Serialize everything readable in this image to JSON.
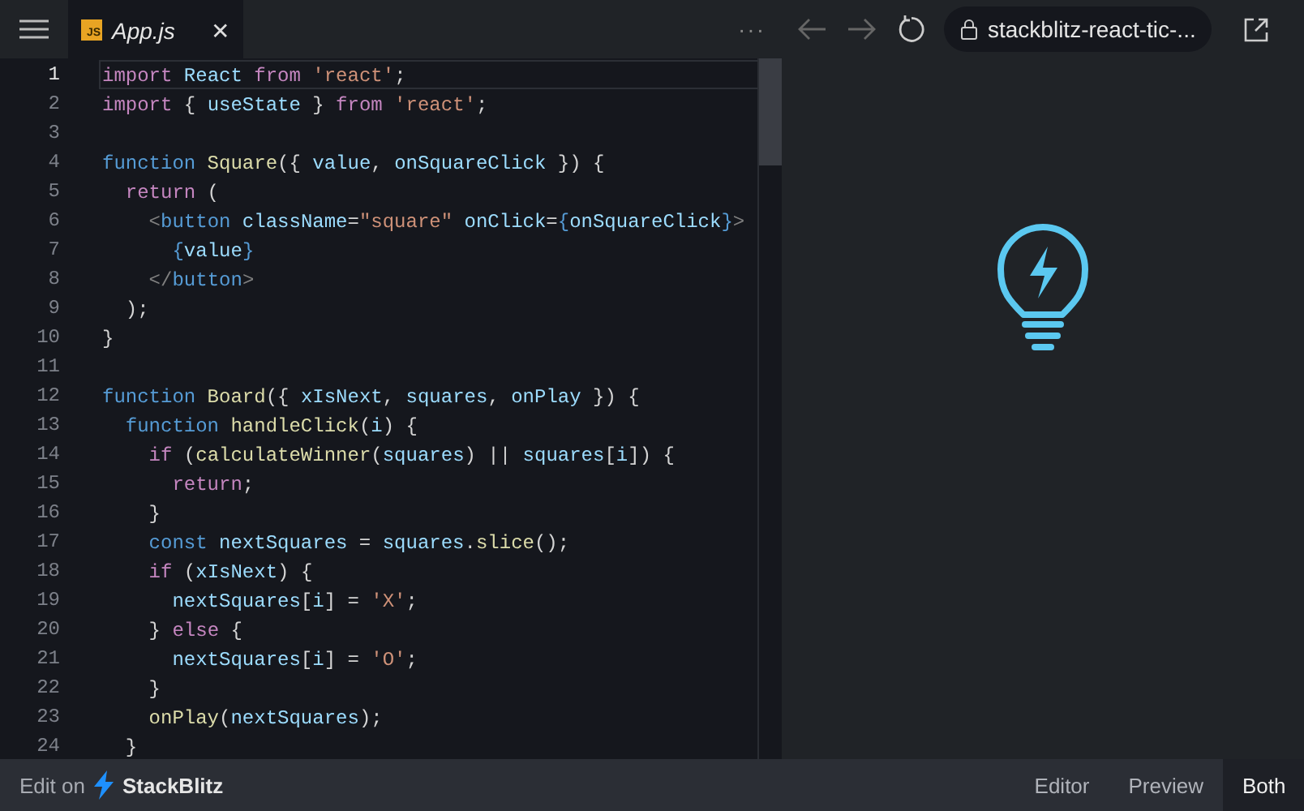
{
  "tab": {
    "icon": "JS",
    "label": "App.js",
    "close": "✕"
  },
  "more": "···",
  "url": "stackblitz-react-tic-...",
  "code": [
    {
      "number": "1",
      "active": true,
      "tokens": [
        {
          "text": "import",
          "kind": "kw"
        },
        {
          "text": " React ",
          "kind": "var"
        },
        {
          "text": "from",
          "kind": "kw"
        },
        {
          "text": " 'react'",
          "kind": "str"
        },
        {
          "text": ";",
          "kind": "p"
        }
      ]
    },
    {
      "number": "2",
      "active": false,
      "tokens": [
        {
          "text": "import",
          "kind": "kw"
        },
        {
          "text": " { ",
          "kind": "p"
        },
        {
          "text": "useState",
          "kind": "var"
        },
        {
          "text": " } ",
          "kind": "p"
        },
        {
          "text": "from",
          "kind": "kw"
        },
        {
          "text": " 'react'",
          "kind": "str"
        },
        {
          "text": ";",
          "kind": "p"
        }
      ]
    },
    {
      "number": "3",
      "active": false
    },
    {
      "number": "4",
      "active": false,
      "tokens": [
        {
          "text": "function",
          "kind": "st"
        },
        {
          "text": " Square",
          "kind": "fn"
        },
        {
          "text": "({ ",
          "kind": "p"
        },
        {
          "text": "value",
          "kind": "var"
        },
        {
          "text": ", ",
          "kind": "p"
        },
        {
          "text": "onSquareClick",
          "kind": "var"
        },
        {
          "text": " }) {",
          "kind": "p"
        }
      ]
    },
    {
      "number": "5",
      "active": false,
      "tokens": [
        {
          "text": "  return",
          "kind": "kw"
        },
        {
          "text": " (",
          "kind": "p"
        }
      ]
    },
    {
      "number": "6",
      "active": false,
      "tokens": [
        {
          "text": "    <",
          "kind": "tag"
        },
        {
          "text": "button",
          "kind": "st"
        },
        {
          "text": " className",
          "kind": "var"
        },
        {
          "text": "=",
          "kind": "p"
        },
        {
          "text": "\"square\"",
          "kind": "str"
        },
        {
          "text": " onClick",
          "kind": "var"
        },
        {
          "text": "=",
          "kind": "p"
        },
        {
          "text": "{",
          "kind": "st"
        },
        {
          "text": "onSquareClick",
          "kind": "var"
        },
        {
          "text": "}",
          "kind": "st"
        },
        {
          "text": ">",
          "kind": "tag"
        }
      ]
    },
    {
      "number": "7",
      "active": false,
      "tokens": [
        {
          "text": "      {",
          "kind": "st"
        },
        {
          "text": "value",
          "kind": "var"
        },
        {
          "text": "}",
          "kind": "st"
        }
      ]
    },
    {
      "number": "8",
      "active": false,
      "tokens": [
        {
          "text": "    </",
          "kind": "tag"
        },
        {
          "text": "button",
          "kind": "st"
        },
        {
          "text": ">",
          "kind": "tag"
        }
      ]
    },
    {
      "number": "9",
      "active": false,
      "tokens": [
        {
          "text": "  );",
          "kind": "p"
        }
      ]
    },
    {
      "number": "10",
      "active": false,
      "tokens": [
        {
          "text": "}",
          "kind": "p"
        }
      ]
    },
    {
      "number": "11",
      "active": false
    },
    {
      "number": "12",
      "active": false,
      "tokens": [
        {
          "text": "function",
          "kind": "st"
        },
        {
          "text": " Board",
          "kind": "fn"
        },
        {
          "text": "({ ",
          "kind": "p"
        },
        {
          "text": "xIsNext",
          "kind": "var"
        },
        {
          "text": ", ",
          "kind": "p"
        },
        {
          "text": "squares",
          "kind": "var"
        },
        {
          "text": ", ",
          "kind": "p"
        },
        {
          "text": "onPlay",
          "kind": "var"
        },
        {
          "text": " }) {",
          "kind": "p"
        }
      ]
    },
    {
      "number": "13",
      "active": false,
      "tokens": [
        {
          "text": "  function",
          "kind": "st"
        },
        {
          "text": " handleClick",
          "kind": "fn"
        },
        {
          "text": "(",
          "kind": "p"
        },
        {
          "text": "i",
          "kind": "var"
        },
        {
          "text": ") {",
          "kind": "p"
        }
      ]
    },
    {
      "number": "14",
      "active": false,
      "tokens": [
        {
          "text": "    if",
          "kind": "kw"
        },
        {
          "text": " (",
          "kind": "p"
        },
        {
          "text": "calculateWinner",
          "kind": "fn"
        },
        {
          "text": "(",
          "kind": "p"
        },
        {
          "text": "squares",
          "kind": "var"
        },
        {
          "text": ") || ",
          "kind": "p"
        },
        {
          "text": "squares",
          "kind": "var"
        },
        {
          "text": "[",
          "kind": "p"
        },
        {
          "text": "i",
          "kind": "var"
        },
        {
          "text": "]) {",
          "kind": "p"
        }
      ]
    },
    {
      "number": "15",
      "active": false,
      "tokens": [
        {
          "text": "      return",
          "kind": "kw"
        },
        {
          "text": ";",
          "kind": "p"
        }
      ]
    },
    {
      "number": "16",
      "active": false,
      "tokens": [
        {
          "text": "    }",
          "kind": "p"
        }
      ]
    },
    {
      "number": "17",
      "active": false,
      "tokens": [
        {
          "text": "    const",
          "kind": "st"
        },
        {
          "text": " nextSquares",
          "kind": "var"
        },
        {
          "text": " = ",
          "kind": "p"
        },
        {
          "text": "squares",
          "kind": "var"
        },
        {
          "text": ".",
          "kind": "p"
        },
        {
          "text": "slice",
          "kind": "fn"
        },
        {
          "text": "();",
          "kind": "p"
        }
      ]
    },
    {
      "number": "18",
      "active": false,
      "tokens": [
        {
          "text": "    if",
          "kind": "kw"
        },
        {
          "text": " (",
          "kind": "p"
        },
        {
          "text": "xIsNext",
          "kind": "var"
        },
        {
          "text": ") {",
          "kind": "p"
        }
      ]
    },
    {
      "number": "19",
      "active": false,
      "tokens": [
        {
          "text": "      nextSquares",
          "kind": "var"
        },
        {
          "text": "[",
          "kind": "p"
        },
        {
          "text": "i",
          "kind": "var"
        },
        {
          "text": "] = ",
          "kind": "p"
        },
        {
          "text": "'X'",
          "kind": "str"
        },
        {
          "text": ";",
          "kind": "p"
        }
      ]
    },
    {
      "number": "20",
      "active": false,
      "tokens": [
        {
          "text": "    } ",
          "kind": "p"
        },
        {
          "text": "else",
          "kind": "kw"
        },
        {
          "text": " {",
          "kind": "p"
        }
      ]
    },
    {
      "number": "21",
      "active": false,
      "tokens": [
        {
          "text": "      nextSquares",
          "kind": "var"
        },
        {
          "text": "[",
          "kind": "p"
        },
        {
          "text": "i",
          "kind": "var"
        },
        {
          "text": "] = ",
          "kind": "p"
        },
        {
          "text": "'O'",
          "kind": "str"
        },
        {
          "text": ";",
          "kind": "p"
        }
      ]
    },
    {
      "number": "22",
      "active": false,
      "tokens": [
        {
          "text": "    }",
          "kind": "p"
        }
      ]
    },
    {
      "number": "23",
      "active": false,
      "tokens": [
        {
          "text": "    onPlay",
          "kind": "fn"
        },
        {
          "text": "(",
          "kind": "p"
        },
        {
          "text": "nextSquares",
          "kind": "var"
        },
        {
          "text": ");",
          "kind": "p"
        }
      ]
    },
    {
      "number": "24",
      "active": false,
      "tokens": [
        {
          "text": "  }",
          "kind": "p"
        }
      ]
    }
  ],
  "footer": {
    "edit_on": "Edit on",
    "brand": "StackBlitz"
  },
  "views": [
    {
      "label": "Editor",
      "selected": false
    },
    {
      "label": "Preview",
      "selected": false
    },
    {
      "label": "Both",
      "selected": true
    }
  ]
}
